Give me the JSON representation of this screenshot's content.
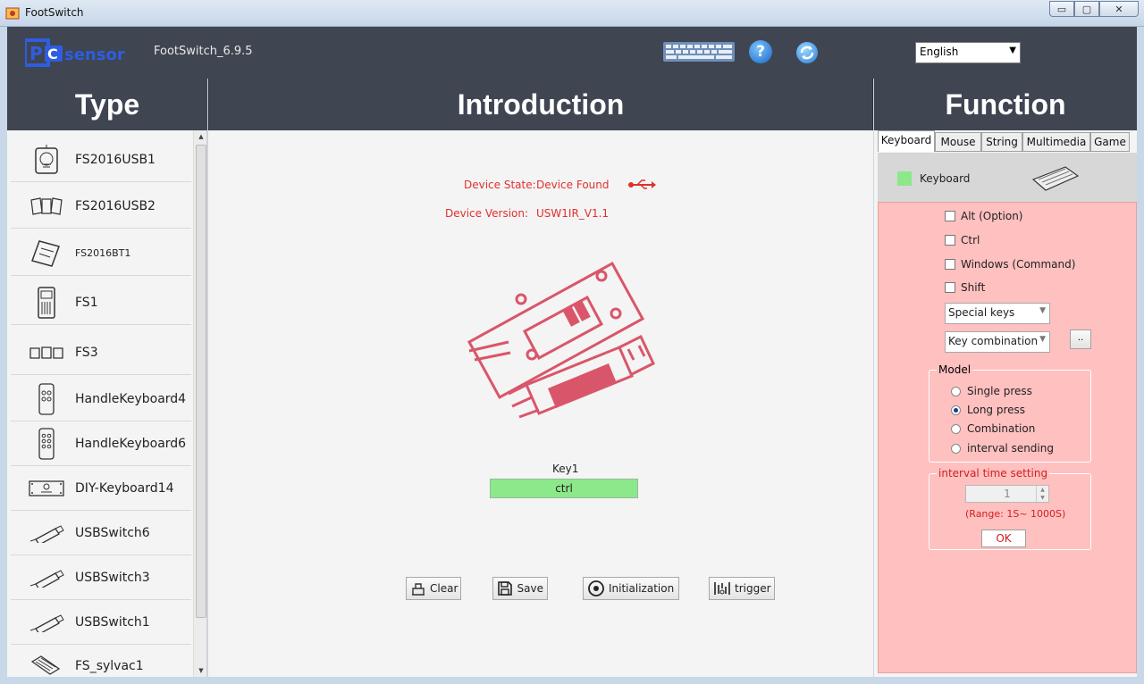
{
  "window": {
    "title": "FootSwitch",
    "minimize_glyph": "▭",
    "maximize_glyph": "▢",
    "close_glyph": "✕"
  },
  "header": {
    "logo": "PCsensor",
    "version": "FootSwitch_6.9.5",
    "language": "English"
  },
  "columns": {
    "type": "Type",
    "introduction": "Introduction",
    "function": "Function"
  },
  "type_list": [
    {
      "label": "FS2016USB1",
      "icon": "pedal-icon"
    },
    {
      "label": "FS2016USB2",
      "icon": "triple-pedal-icon"
    },
    {
      "label": "FS2016BT1",
      "icon": "bt-pedal-icon"
    },
    {
      "label": "FS1",
      "icon": "single-switch-icon"
    },
    {
      "label": "FS3",
      "icon": "triple-switch-icon"
    },
    {
      "label": "HandleKeyboard4",
      "icon": "handle-keyboard-icon"
    },
    {
      "label": "HandleKeyboard6",
      "icon": "handle-keyboard-icon"
    },
    {
      "label": "DIY-Keyboard14",
      "icon": "diy-keyboard-icon"
    },
    {
      "label": "USBSwitch6",
      "icon": "usb-stick-icon"
    },
    {
      "label": "USBSwitch3",
      "icon": "usb-stick-icon"
    },
    {
      "label": "USBSwitch1",
      "icon": "usb-stick-icon"
    },
    {
      "label": "FS_sylvac1",
      "icon": "sylvac-icon"
    }
  ],
  "intro": {
    "device_state_label": "Device State:",
    "device_state_value": "Device Found",
    "device_version_label": "Device Version:",
    "device_version_value": "USW1IR_V1.1",
    "key_label": "Key1",
    "key_value": "ctrl",
    "buttons": {
      "clear": "Clear",
      "save": "Save",
      "init": "Initialization",
      "trigger": "trigger"
    }
  },
  "function": {
    "tabs": [
      "Keyboard",
      "Mouse",
      "String",
      "Multimedia",
      "Game"
    ],
    "active_tab": "Keyboard",
    "mode_label": "Keyboard",
    "modifiers": [
      "Alt (Option)",
      "Ctrl",
      "Windows (Command)",
      "Shift"
    ],
    "special_keys": "Special keys",
    "key_combination": "Key combination",
    "dots_label": "..",
    "model_legend": "Model",
    "model_options": [
      "Single press",
      "Long press",
      "Combination",
      "interval sending"
    ],
    "model_selected": 1,
    "interval_legend": "interval time setting",
    "interval_value": "1",
    "range_text": "(Range: 1S~ 1000S)",
    "ok_label": "OK"
  },
  "colors": {
    "header_bg": "#3f4551",
    "accent_red": "#e03030",
    "key_green": "#8ce88a",
    "pink_panel": "#ffc0c0"
  }
}
